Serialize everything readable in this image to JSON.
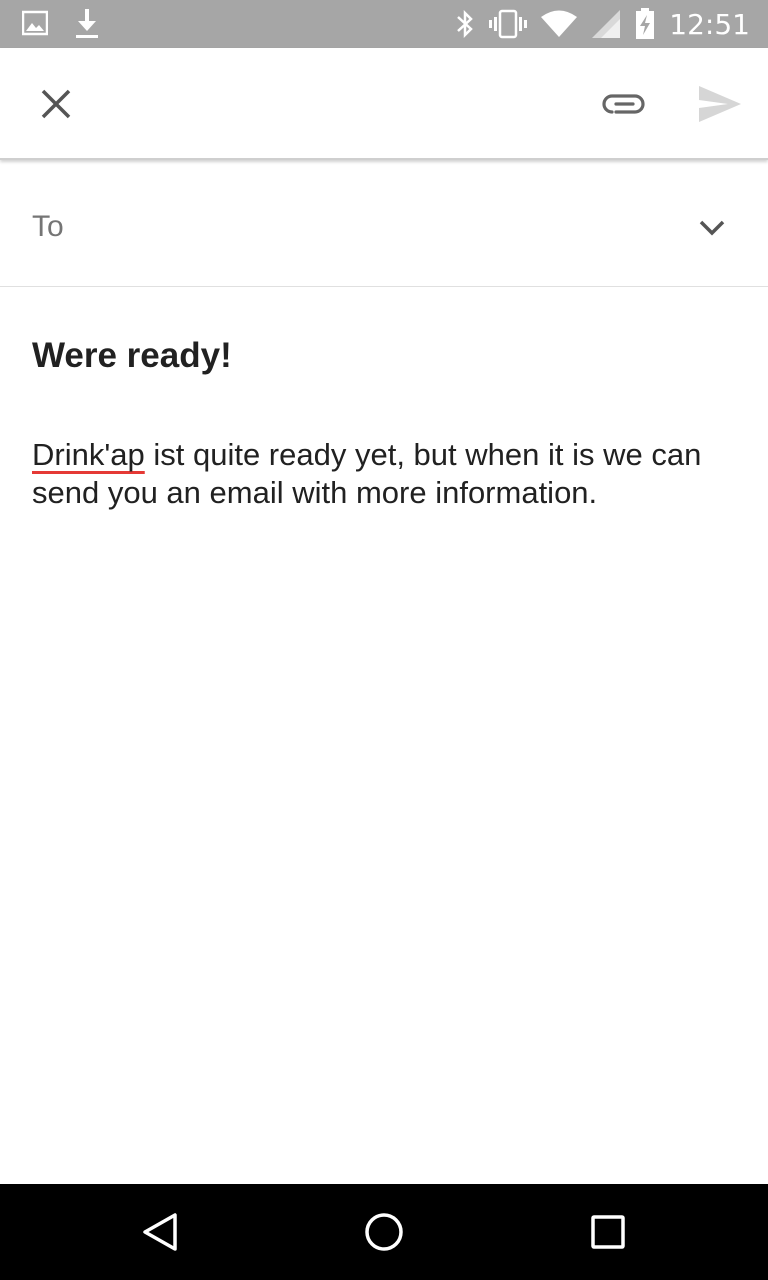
{
  "status_bar": {
    "time": "12:51",
    "icons": [
      "image-icon",
      "download-icon",
      "bluetooth-icon",
      "vibrate-icon",
      "wifi-icon",
      "signal-icon",
      "battery-charging-icon"
    ]
  },
  "toolbar": {
    "close_icon": "close-icon",
    "attach_icon": "paperclip-icon",
    "send_icon": "send-icon"
  },
  "compose": {
    "to_label": "To",
    "to_value": "",
    "subject": "Were ready!",
    "body_misspelled": "Drink'ap",
    "body_rest": " ist quite ready yet, but when it is we can send you an email with more information."
  },
  "colors": {
    "status_bar": "#a6a6a6",
    "spellcheck_underline": "#e53935",
    "text": "#212121",
    "label": "#757575"
  }
}
